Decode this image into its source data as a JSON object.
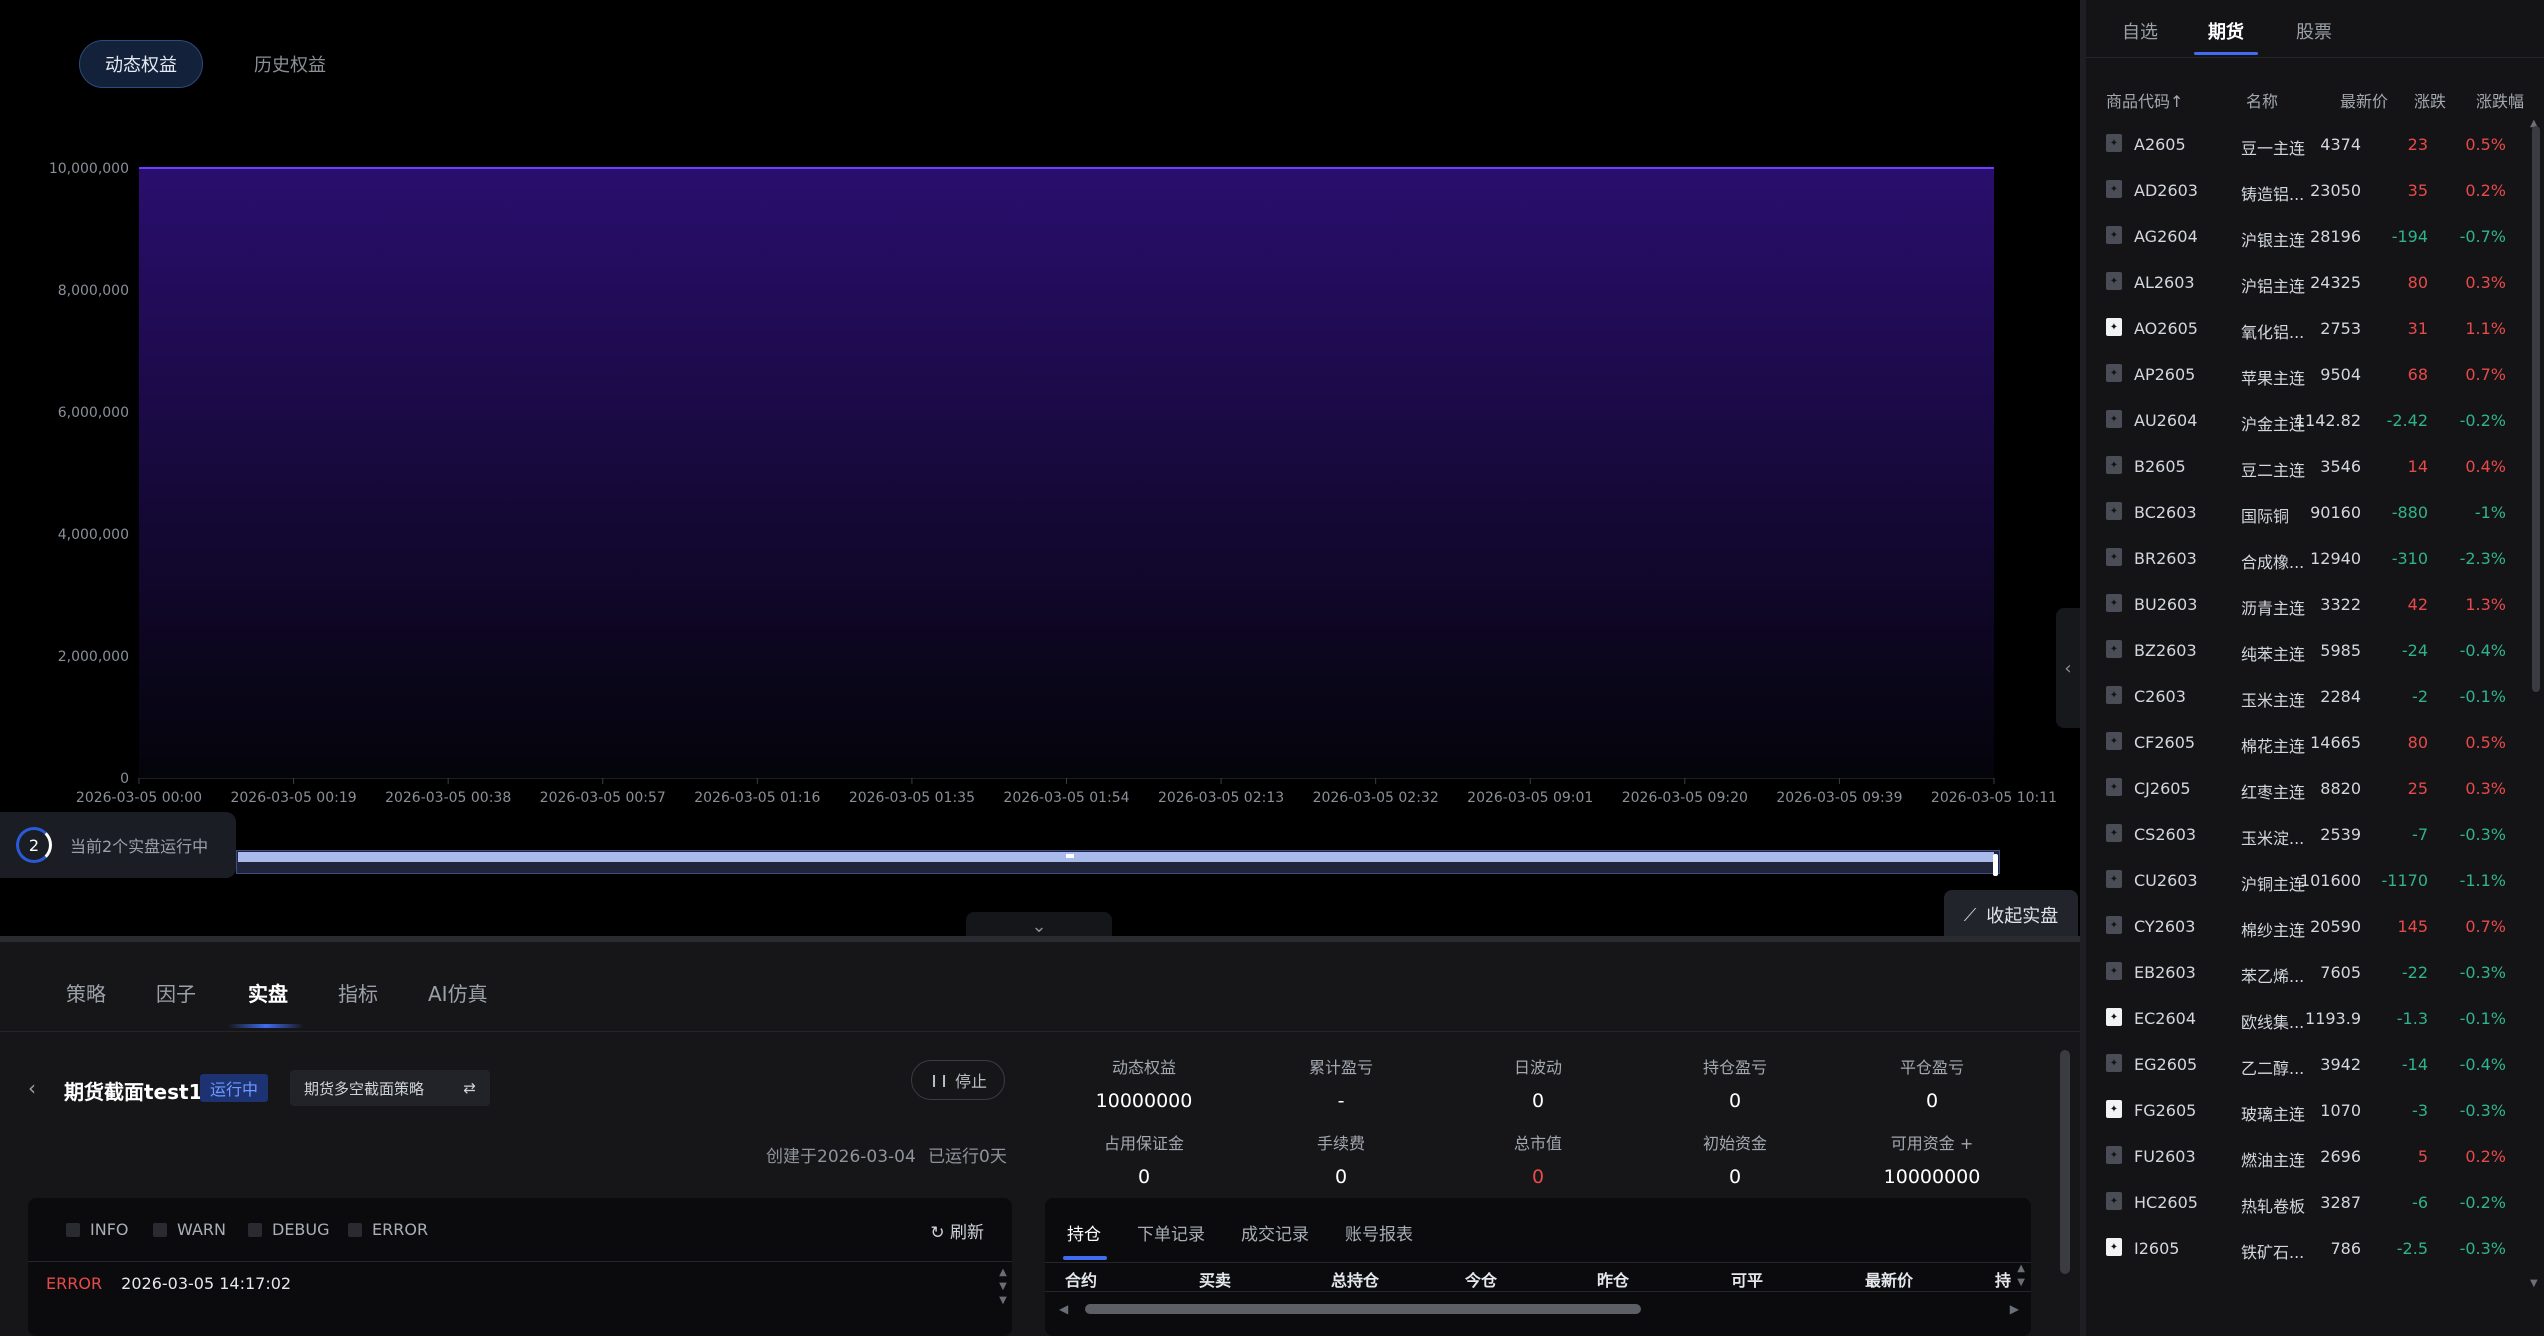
{
  "top_tabs": {
    "dynamic": "动态权益",
    "history": "历史权益"
  },
  "chart_data": {
    "type": "area",
    "series": [
      {
        "values": [
          10000000,
          10000000,
          10000000,
          10000000,
          10000000,
          10000000,
          10000000,
          10000000,
          10000000,
          10000000,
          10000000,
          10000000,
          10000000
        ]
      }
    ],
    "x": [
      "2026-03-05 00:00",
      "2026-03-05 00:19",
      "2026-03-05 00:38",
      "2026-03-05 00:57",
      "2026-03-05 01:16",
      "2026-03-05 01:35",
      "2026-03-05 01:54",
      "2026-03-05 02:13",
      "2026-03-05 02:32",
      "2026-03-05 09:01",
      "2026-03-05 09:20",
      "2026-03-05 09:39",
      "2026-03-05 10:11"
    ],
    "yticks": [
      "0",
      "2,000,000",
      "4,000,000",
      "6,000,000",
      "8,000,000",
      "10,000,000"
    ],
    "ylim": [
      0,
      10000000
    ],
    "grid": true,
    "colors": {
      "line": "#6f3dff",
      "fill_top": "#2a0e6e"
    }
  },
  "running": {
    "count": "2",
    "text": "当前2个实盘运行中"
  },
  "fold_live": "收起实盘",
  "bottom_nav": [
    "策略",
    "因子",
    "实盘",
    "指标",
    "AI仿真"
  ],
  "strategy": {
    "back": "‹",
    "name": "期货截面test1",
    "status": "运行中",
    "select": "期货多空截面策略",
    "stop": "停止",
    "created": "创建于2026-03-04",
    "uptime": "已运行0天"
  },
  "stats": [
    {
      "label": "动态权益",
      "value": "10000000"
    },
    {
      "label": "累计盈亏",
      "value": "-"
    },
    {
      "label": "日波动",
      "value": "0"
    },
    {
      "label": "持仓盈亏",
      "value": "0"
    },
    {
      "label": "平仓盈亏",
      "value": "0"
    },
    {
      "label": "占用保证金",
      "value": "0"
    },
    {
      "label": "手续费",
      "value": "0"
    },
    {
      "label": "总市值",
      "value": "0",
      "red": true
    },
    {
      "label": "初始资金",
      "value": "0"
    },
    {
      "label": "可用资金 +",
      "value": "10000000"
    }
  ],
  "log": {
    "filters": [
      "INFO",
      "WARN",
      "DEBUG",
      "ERROR"
    ],
    "refresh": "刷新",
    "line_level": "ERROR",
    "line_time": "2026-03-05 14:17:02"
  },
  "positions": {
    "tabs": [
      "持仓",
      "下单记录",
      "成交记录",
      "账号报表"
    ],
    "columns": [
      "合约",
      "买卖",
      "总持仓",
      "今仓",
      "昨仓",
      "可平",
      "最新价",
      "持"
    ]
  },
  "market": {
    "tabs": [
      "自选",
      "期货",
      "股票"
    ],
    "headers": [
      "商品代码↑",
      "名称",
      "最新价",
      "涨跌",
      "涨跌幅"
    ],
    "rows": [
      {
        "code": "A2605",
        "name": "豆一主连",
        "price": "4374",
        "chg": "23",
        "pct": "0.5%",
        "up": true,
        "fav": false
      },
      {
        "code": "AD2603",
        "name": "铸造铝...",
        "price": "23050",
        "chg": "35",
        "pct": "0.2%",
        "up": true,
        "fav": false
      },
      {
        "code": "AG2604",
        "name": "沪银主连",
        "price": "28196",
        "chg": "-194",
        "pct": "-0.7%",
        "up": false,
        "fav": false
      },
      {
        "code": "AL2603",
        "name": "沪铝主连",
        "price": "24325",
        "chg": "80",
        "pct": "0.3%",
        "up": true,
        "fav": false
      },
      {
        "code": "AO2605",
        "name": "氧化铝...",
        "price": "2753",
        "chg": "31",
        "pct": "1.1%",
        "up": true,
        "fav": true
      },
      {
        "code": "AP2605",
        "name": "苹果主连",
        "price": "9504",
        "chg": "68",
        "pct": "0.7%",
        "up": true,
        "fav": false
      },
      {
        "code": "AU2604",
        "name": "沪金主连",
        "price": "1142.82",
        "chg": "-2.42",
        "pct": "-0.2%",
        "up": false,
        "fav": false
      },
      {
        "code": "B2605",
        "name": "豆二主连",
        "price": "3546",
        "chg": "14",
        "pct": "0.4%",
        "up": true,
        "fav": false
      },
      {
        "code": "BC2603",
        "name": "国际铜",
        "price": "90160",
        "chg": "-880",
        "pct": "-1%",
        "up": false,
        "fav": false
      },
      {
        "code": "BR2603",
        "name": "合成橡...",
        "price": "12940",
        "chg": "-310",
        "pct": "-2.3%",
        "up": false,
        "fav": false
      },
      {
        "code": "BU2603",
        "name": "沥青主连",
        "price": "3322",
        "chg": "42",
        "pct": "1.3%",
        "up": true,
        "fav": false
      },
      {
        "code": "BZ2603",
        "name": "纯苯主连",
        "price": "5985",
        "chg": "-24",
        "pct": "-0.4%",
        "up": false,
        "fav": false
      },
      {
        "code": "C2603",
        "name": "玉米主连",
        "price": "2284",
        "chg": "-2",
        "pct": "-0.1%",
        "up": false,
        "fav": false
      },
      {
        "code": "CF2605",
        "name": "棉花主连",
        "price": "14665",
        "chg": "80",
        "pct": "0.5%",
        "up": true,
        "fav": false
      },
      {
        "code": "CJ2605",
        "name": "红枣主连",
        "price": "8820",
        "chg": "25",
        "pct": "0.3%",
        "up": true,
        "fav": false
      },
      {
        "code": "CS2603",
        "name": "玉米淀...",
        "price": "2539",
        "chg": "-7",
        "pct": "-0.3%",
        "up": false,
        "fav": false
      },
      {
        "code": "CU2603",
        "name": "沪铜主连",
        "price": "101600",
        "chg": "-1170",
        "pct": "-1.1%",
        "up": false,
        "fav": false
      },
      {
        "code": "CY2603",
        "name": "棉纱主连",
        "price": "20590",
        "chg": "145",
        "pct": "0.7%",
        "up": true,
        "fav": false
      },
      {
        "code": "EB2603",
        "name": "苯乙烯...",
        "price": "7605",
        "chg": "-22",
        "pct": "-0.3%",
        "up": false,
        "fav": false
      },
      {
        "code": "EC2604",
        "name": "欧线集...",
        "price": "1193.9",
        "chg": "-1.3",
        "pct": "-0.1%",
        "up": false,
        "fav": true
      },
      {
        "code": "EG2605",
        "name": "乙二醇...",
        "price": "3942",
        "chg": "-14",
        "pct": "-0.4%",
        "up": false,
        "fav": false
      },
      {
        "code": "FG2605",
        "name": "玻璃主连",
        "price": "1070",
        "chg": "-3",
        "pct": "-0.3%",
        "up": false,
        "fav": true
      },
      {
        "code": "FU2603",
        "name": "燃油主连",
        "price": "2696",
        "chg": "5",
        "pct": "0.2%",
        "up": true,
        "fav": false
      },
      {
        "code": "HC2605",
        "name": "热轧卷板",
        "price": "3287",
        "chg": "-6",
        "pct": "-0.2%",
        "up": false,
        "fav": false
      },
      {
        "code": "I2605",
        "name": "铁矿石...",
        "price": "786",
        "chg": "-2.5",
        "pct": "-0.3%",
        "up": false,
        "fav": true
      }
    ]
  }
}
